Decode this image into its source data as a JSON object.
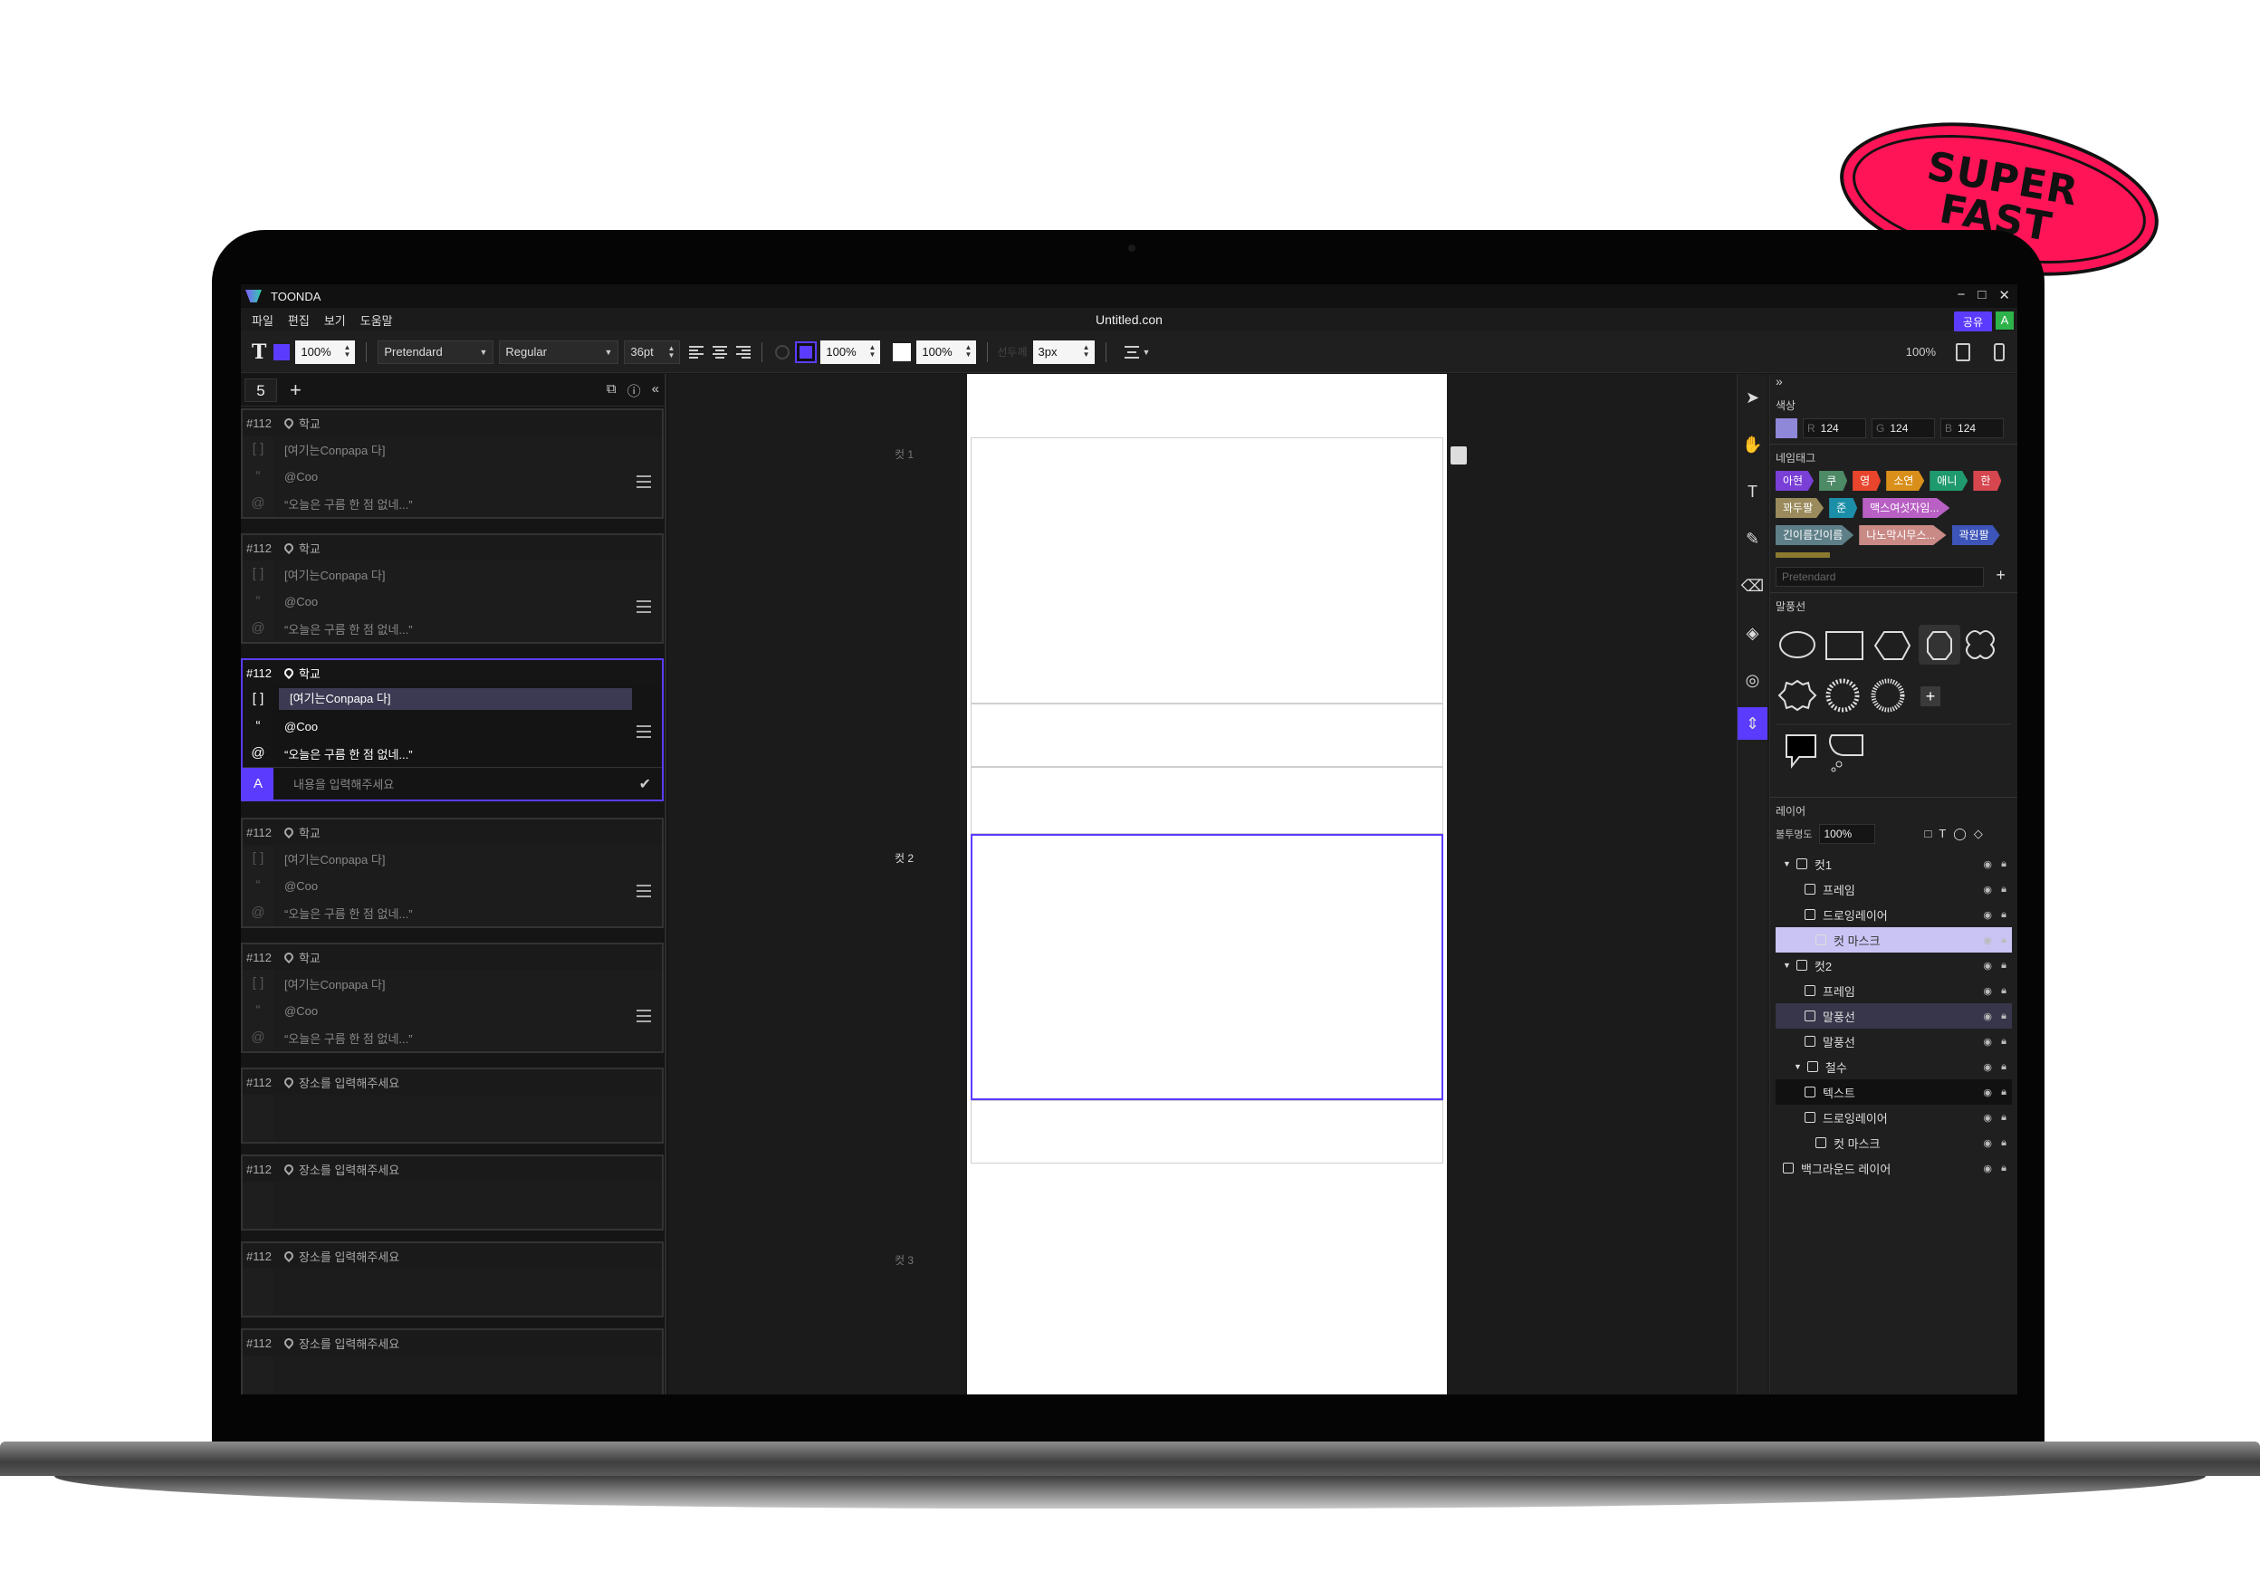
{
  "stamp": {
    "line1": "SUPER",
    "line2": "FAST"
  },
  "app": {
    "name": "TOONDA",
    "doc_title": "Untitled.con",
    "share": "공유",
    "avatar": "A",
    "win": [
      "−",
      "□",
      "✕"
    ]
  },
  "menu": [
    "파일",
    "편집",
    "보기",
    "도움말"
  ],
  "toolbar": {
    "zoom1": "100%",
    "font": "Pretendard",
    "weight": "Regular",
    "size": "36pt",
    "fill_opacity": "100%",
    "stroke_opacity": "100%",
    "stroke_label": "선두께",
    "stroke": "3px",
    "view_zoom": "100%",
    "accent": "#5b3cff"
  },
  "left": {
    "count": "5",
    "plus": "+"
  },
  "cards": [
    {
      "num": "#112",
      "place": "학교",
      "desc": "[여기는Conpapa 다]",
      "char": "@Coo",
      "line": "“오늘은 구름 한 점 없네...”"
    },
    {
      "num": "#112",
      "place": "학교",
      "desc": "[여기는Conpapa 다]",
      "char": "@Coo",
      "line": "“오늘은 구름 한 점 없네...”"
    },
    {
      "num": "#112",
      "place": "학교",
      "desc": "[여기는Conpapa 다]",
      "char": "@Coo",
      "line": "“오늘은 구름 한 점 없네...”",
      "input": "내용을 입력해주세요"
    },
    {
      "num": "#112",
      "place": "학교",
      "desc": "[여기는Conpapa 다]",
      "char": "@Coo",
      "line": "“오늘은 구름 한 점 없네...”"
    },
    {
      "num": "#112",
      "place": "학교",
      "desc": "[여기는Conpapa 다]",
      "char": "@Coo",
      "line": "“오늘은 구름 한 점 없네...”"
    },
    {
      "num": "#112",
      "place": "장소를 입력해주세요"
    },
    {
      "num": "#112",
      "place": "장소를 입력해주세요"
    },
    {
      "num": "#112",
      "place": "장소를 입력해주세요"
    },
    {
      "num": "#112",
      "place": "장소를 입력해주세요"
    }
  ],
  "canvas": {
    "cut1": "컷 1",
    "cut2": "컷 2",
    "cut3": "컷 3"
  },
  "right": {
    "color_title": "색상",
    "r": "124",
    "g": "124",
    "b": "124",
    "swatch": "#8f87d8",
    "tag_title": "네임태그",
    "tags": [
      {
        "label": "아현",
        "color": "#7a3fd6"
      },
      {
        "label": "쿠",
        "color": "#4d8a66"
      },
      {
        "label": "영",
        "color": "#e8452c"
      },
      {
        "label": "소연",
        "color": "#d98f1a"
      },
      {
        "label": "애니",
        "color": "#1f9a6e"
      },
      {
        "label": "한",
        "color": "#d6464e"
      },
      {
        "label": "꽈두팔",
        "color": "#9a8a5c"
      },
      {
        "label": "준",
        "color": "#1c8fa8"
      },
      {
        "label": "맥스여섯자임...",
        "color": "#b860c4"
      },
      {
        "label": "긴이름긴이름",
        "color": "#5e7f88"
      },
      {
        "label": "나노막시무스...",
        "color": "#c98a86"
      },
      {
        "label": "곽원팔",
        "color": "#3d54b8"
      }
    ],
    "font_ph": "Pretendard",
    "bubble_title": "말풍선",
    "layer_title": "레이어",
    "opacity_label": "불투명도",
    "opacity": "100%",
    "layers": [
      {
        "label": "컷1",
        "indent": 0
      },
      {
        "label": "프레임",
        "indent": 2
      },
      {
        "label": "드로잉레이어",
        "indent": 2
      },
      {
        "label": "컷 마스크",
        "indent": 3
      },
      {
        "label": "컷2",
        "indent": 0
      },
      {
        "label": "프레임",
        "indent": 2
      },
      {
        "label": "말풍선",
        "indent": 2
      },
      {
        "label": "말풍선",
        "indent": 2
      },
      {
        "label": "철수",
        "indent": 1
      },
      {
        "label": "텍스트",
        "indent": 2
      },
      {
        "label": "드로잉레이어",
        "indent": 2
      },
      {
        "label": "컷 마스크",
        "indent": 3
      },
      {
        "label": "백그라운드 레이어",
        "indent": 0
      }
    ]
  }
}
